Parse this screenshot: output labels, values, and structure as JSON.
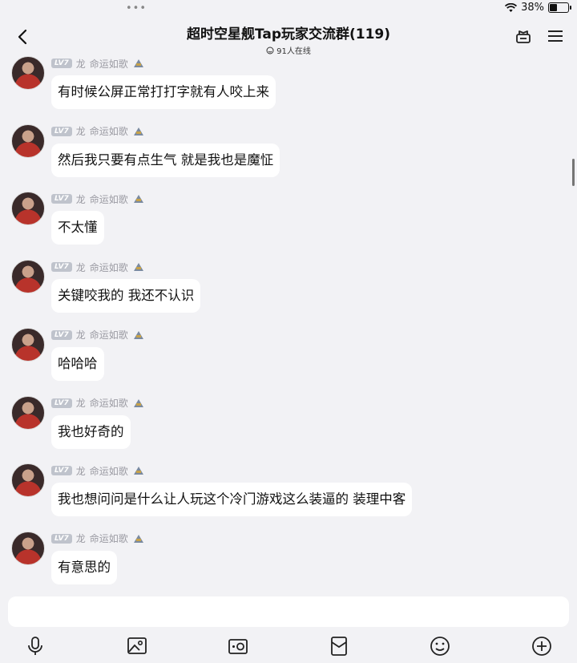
{
  "status": {
    "battery": "38%",
    "battery_level": 0.38
  },
  "header": {
    "title": "超时空星舰Tap玩家交流群(119)",
    "online": "91人在线"
  },
  "sender": {
    "level": "LV7",
    "role": "龙",
    "name": "命运如歌"
  },
  "messages": [
    {
      "text": "有时候公屏正常打打字就有人咬上来"
    },
    {
      "text": "然后我只要有点生气 就是我也是魔怔"
    },
    {
      "text": "不太懂"
    },
    {
      "text": "关键咬我的 我还不认识"
    },
    {
      "text": "哈哈哈"
    },
    {
      "text": "我也好奇的"
    },
    {
      "text": "我也想问问是什么让人玩这个冷门游戏这么装逼的 装理中客"
    },
    {
      "text": "有意思的"
    }
  ],
  "input": {
    "value": "",
    "placeholder": ""
  },
  "toolbar": [
    "voice-icon",
    "image-icon",
    "camera-icon",
    "red-packet-icon",
    "emoji-icon",
    "plus-icon"
  ]
}
